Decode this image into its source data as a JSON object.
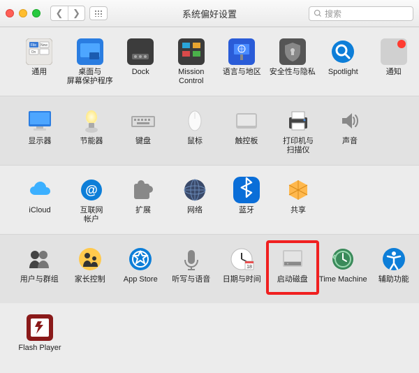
{
  "window": {
    "title": "系统偏好设置"
  },
  "search": {
    "placeholder": "搜索"
  },
  "sections": [
    {
      "alt": false,
      "items": [
        {
          "key": "general",
          "label": "通用"
        },
        {
          "key": "desktop",
          "label": "桌面与\n屏幕保护程序"
        },
        {
          "key": "dock",
          "label": "Dock"
        },
        {
          "key": "mission",
          "label": "Mission\nControl"
        },
        {
          "key": "language",
          "label": "语言与地区"
        },
        {
          "key": "security",
          "label": "安全性与隐私"
        },
        {
          "key": "spotlight",
          "label": "Spotlight"
        },
        {
          "key": "notifications",
          "label": "通知"
        }
      ]
    },
    {
      "alt": true,
      "items": [
        {
          "key": "displays",
          "label": "显示器"
        },
        {
          "key": "energy",
          "label": "节能器"
        },
        {
          "key": "keyboard",
          "label": "键盘"
        },
        {
          "key": "mouse",
          "label": "鼠标"
        },
        {
          "key": "trackpad",
          "label": "触控板"
        },
        {
          "key": "printers",
          "label": "打印机与\n扫描仪"
        },
        {
          "key": "sound",
          "label": "声音"
        }
      ]
    },
    {
      "alt": false,
      "items": [
        {
          "key": "icloud",
          "label": "iCloud"
        },
        {
          "key": "internet",
          "label": "互联网\n帐户"
        },
        {
          "key": "extensions",
          "label": "扩展"
        },
        {
          "key": "network",
          "label": "网络"
        },
        {
          "key": "bluetooth",
          "label": "蓝牙"
        },
        {
          "key": "sharing",
          "label": "共享"
        }
      ]
    },
    {
      "alt": true,
      "items": [
        {
          "key": "users",
          "label": "用户与群组"
        },
        {
          "key": "parental",
          "label": "家长控制"
        },
        {
          "key": "appstore",
          "label": "App Store"
        },
        {
          "key": "dictation",
          "label": "听写与语音"
        },
        {
          "key": "datetime",
          "label": "日期与时间"
        },
        {
          "key": "startup",
          "label": "启动磁盘",
          "highlight": true
        },
        {
          "key": "timemachine",
          "label": "Time Machine"
        },
        {
          "key": "accessibility",
          "label": "辅助功能"
        }
      ]
    }
  ],
  "thirdparty": [
    {
      "key": "flash",
      "label": "Flash Player"
    }
  ]
}
